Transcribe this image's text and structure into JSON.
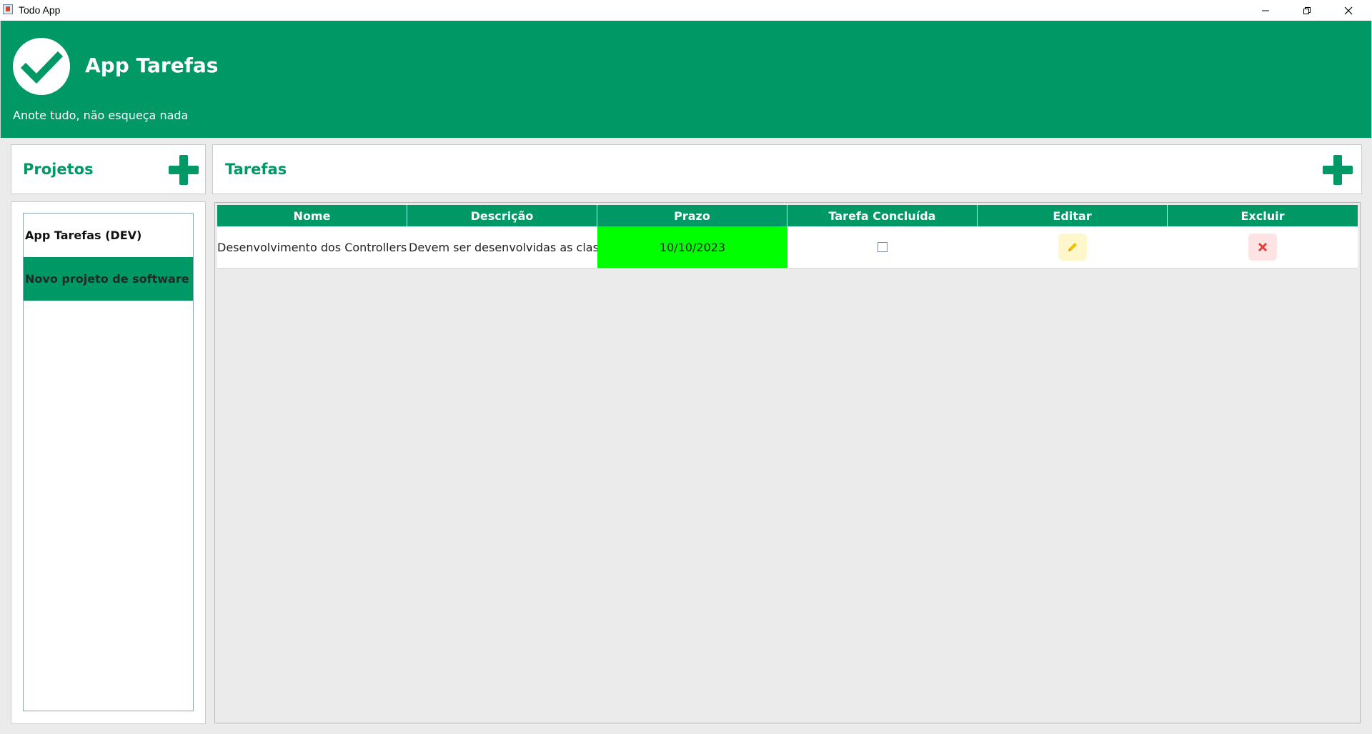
{
  "window": {
    "title": "Todo App"
  },
  "header": {
    "title": "App Tarefas",
    "subtitle": "Anote tudo, não esqueça nada",
    "brand_color": "#009966"
  },
  "projects": {
    "title": "Projetos",
    "items": [
      {
        "label": "App Tarefas (DEV)",
        "selected": false
      },
      {
        "label": "Novo projeto de software",
        "selected": true
      }
    ]
  },
  "tasks": {
    "title": "Tarefas",
    "columns": [
      "Nome",
      "Descrição",
      "Prazo",
      "Tarefa Concluída",
      "Editar",
      "Excluir"
    ],
    "rows": [
      {
        "name": "Desenvolvimento dos Controllers",
        "description": "Devem ser desenvolvidas as clas...",
        "deadline": "10/10/2023",
        "completed": false,
        "deadline_color": "#00ff00"
      }
    ]
  },
  "icons": {
    "logo": "check-circle-icon",
    "add_project": "plus-icon",
    "add_task": "plus-icon",
    "edit": "pencil-icon",
    "delete": "close-icon"
  }
}
